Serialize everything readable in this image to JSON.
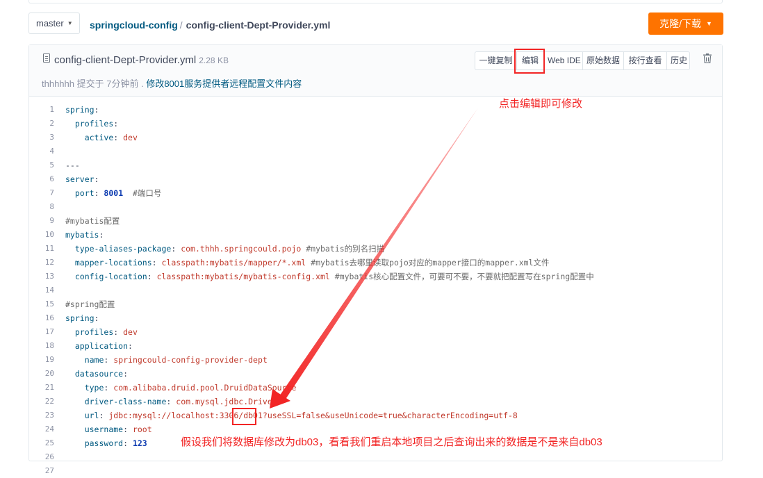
{
  "branch": {
    "name": "master"
  },
  "breadcrumb": {
    "repo": "springcloud-config",
    "separator": "/",
    "file": "config-client-Dept-Provider.yml"
  },
  "clone_button": {
    "label": "克隆/下载"
  },
  "file": {
    "name": "config-client-Dept-Provider.yml",
    "size": "2.28 KB",
    "author": "thhhhhh",
    "commit_meta": "提交于 7分钟前 .",
    "commit_message": "修改8001服务提供者远程配置文件内容"
  },
  "actions": [
    "一键复制",
    "编辑",
    "Web IDE",
    "原始数据",
    "按行查看",
    "历史"
  ],
  "icons": {
    "file": "file-icon",
    "trash": "trash-icon",
    "caret": "caret-down-icon"
  },
  "colors": {
    "accent": "#fe7300",
    "link": "#005980",
    "annotation": "#f22525"
  },
  "code_lines": [
    [
      [
        "k",
        "spring"
      ],
      [
        "p",
        ":"
      ]
    ],
    [
      [
        "p",
        "  "
      ],
      [
        "k",
        "profiles"
      ],
      [
        "p",
        ":"
      ]
    ],
    [
      [
        "p",
        "    "
      ],
      [
        "k",
        "active"
      ],
      [
        "p",
        ": "
      ],
      [
        "s",
        "dev"
      ]
    ],
    [],
    [
      [
        "p",
        "---"
      ]
    ],
    [
      [
        "k",
        "server"
      ],
      [
        "p",
        ":"
      ]
    ],
    [
      [
        "p",
        "  "
      ],
      [
        "k",
        "port"
      ],
      [
        "p",
        ": "
      ],
      [
        "n",
        "8001"
      ],
      [
        "p",
        "  "
      ],
      [
        "c",
        "#端口号"
      ]
    ],
    [],
    [
      [
        "c",
        "#mybatis配置"
      ]
    ],
    [
      [
        "k",
        "mybatis"
      ],
      [
        "p",
        ":"
      ]
    ],
    [
      [
        "p",
        "  "
      ],
      [
        "k",
        "type-aliases-package"
      ],
      [
        "p",
        ": "
      ],
      [
        "s",
        "com.thhh.springcould.pojo"
      ],
      [
        "p",
        " "
      ],
      [
        "c",
        "#mybatis的别名扫描"
      ]
    ],
    [
      [
        "p",
        "  "
      ],
      [
        "k",
        "mapper-locations"
      ],
      [
        "p",
        ": "
      ],
      [
        "s",
        "classpath:mybatis/mapper/*.xml"
      ],
      [
        "p",
        " "
      ],
      [
        "c",
        "#mybatis去哪里读取pojo对应的mapper接口的mapper.xml文件"
      ]
    ],
    [
      [
        "p",
        "  "
      ],
      [
        "k",
        "config-location"
      ],
      [
        "p",
        ": "
      ],
      [
        "s",
        "classpath:mybatis/mybatis-config.xml"
      ],
      [
        "p",
        " "
      ],
      [
        "c",
        "#mybatis核心配置文件，可要可不要，不要就把配置写在spring配置中"
      ]
    ],
    [],
    [
      [
        "c",
        "#spring配置"
      ]
    ],
    [
      [
        "k",
        "spring"
      ],
      [
        "p",
        ":"
      ]
    ],
    [
      [
        "p",
        "  "
      ],
      [
        "k",
        "profiles"
      ],
      [
        "p",
        ": "
      ],
      [
        "s",
        "dev"
      ]
    ],
    [
      [
        "p",
        "  "
      ],
      [
        "k",
        "application"
      ],
      [
        "p",
        ":"
      ]
    ],
    [
      [
        "p",
        "    "
      ],
      [
        "k",
        "name"
      ],
      [
        "p",
        ": "
      ],
      [
        "s",
        "springcould-config-provider-dept"
      ]
    ],
    [
      [
        "p",
        "  "
      ],
      [
        "k",
        "datasource"
      ],
      [
        "p",
        ":"
      ]
    ],
    [
      [
        "p",
        "    "
      ],
      [
        "k",
        "type"
      ],
      [
        "p",
        ": "
      ],
      [
        "s",
        "com.alibaba.druid.pool.DruidDataSource"
      ]
    ],
    [
      [
        "p",
        "    "
      ],
      [
        "k",
        "driver-class-name"
      ],
      [
        "p",
        ": "
      ],
      [
        "s",
        "com.mysql.jdbc.Driver"
      ]
    ],
    [
      [
        "p",
        "    "
      ],
      [
        "k",
        "url"
      ],
      [
        "p",
        ": "
      ],
      [
        "s",
        "jdbc:mysql://localhost:3306/db01?useSSL=false&useUnicode=true&characterEncoding=utf-8"
      ]
    ],
    [
      [
        "p",
        "    "
      ],
      [
        "k",
        "username"
      ],
      [
        "p",
        ": "
      ],
      [
        "s",
        "root"
      ]
    ],
    [
      [
        "p",
        "    "
      ],
      [
        "k",
        "password"
      ],
      [
        "p",
        ": "
      ],
      [
        "n",
        "123"
      ]
    ],
    [],
    []
  ],
  "annotations": {
    "edit_hint": "点击编辑即可修改",
    "db_hint": "假设我们将数据库修改为db03，看看我们重启本地项目之后查询出来的数据是不是来自db03"
  }
}
